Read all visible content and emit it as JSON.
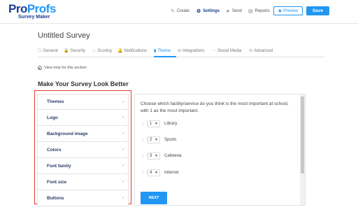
{
  "logo": {
    "pro": "Pro",
    "profs": "Profs",
    "sub": "Survey Maker"
  },
  "nav": [
    {
      "label": "Create",
      "icon": "pencil-icon",
      "glyph": "✎",
      "active": false
    },
    {
      "label": "Settings",
      "icon": "gear-icon",
      "glyph": "⚙",
      "active": true
    },
    {
      "label": "Send",
      "icon": "send-icon",
      "glyph": "➤",
      "active": false
    },
    {
      "label": "Reports",
      "icon": "reports-icon",
      "glyph": "▤",
      "active": false
    }
  ],
  "buttons": {
    "preview": "Preview",
    "save": "Save"
  },
  "title": "Untitled Survey",
  "tabs": [
    {
      "label": "General",
      "glyph": "☐"
    },
    {
      "label": "Security",
      "glyph": "🔒"
    },
    {
      "label": "Scoring",
      "glyph": "☆"
    },
    {
      "label": "Notifications",
      "glyph": "🔔"
    },
    {
      "label": "Theme",
      "glyph": "▮"
    },
    {
      "label": "Integrations",
      "glyph": "⊞"
    },
    {
      "label": "Social Media",
      "glyph": "⋯"
    },
    {
      "label": "Advanced",
      "glyph": "⚙"
    }
  ],
  "help": "View help for this section",
  "section_heading": "Make Your Survey Look Better",
  "sidebar": [
    "Themes",
    "Logo",
    "Background image",
    "Colors",
    "Font family",
    "Font size",
    "Buttons"
  ],
  "question": "Choose which facility/service do you think is the most important at school, with 1 as the most important.",
  "rank_items": [
    {
      "rank": "1",
      "label": "Library"
    },
    {
      "rank": "2",
      "label": "Sports"
    },
    {
      "rank": "3",
      "label": "Cafeteria"
    },
    {
      "rank": "4",
      "label": "Internet"
    }
  ],
  "next_label": "NEXT",
  "colors": {
    "accent": "#2196f3",
    "brand": "#1b3d8f",
    "highlight": "#e53935"
  }
}
